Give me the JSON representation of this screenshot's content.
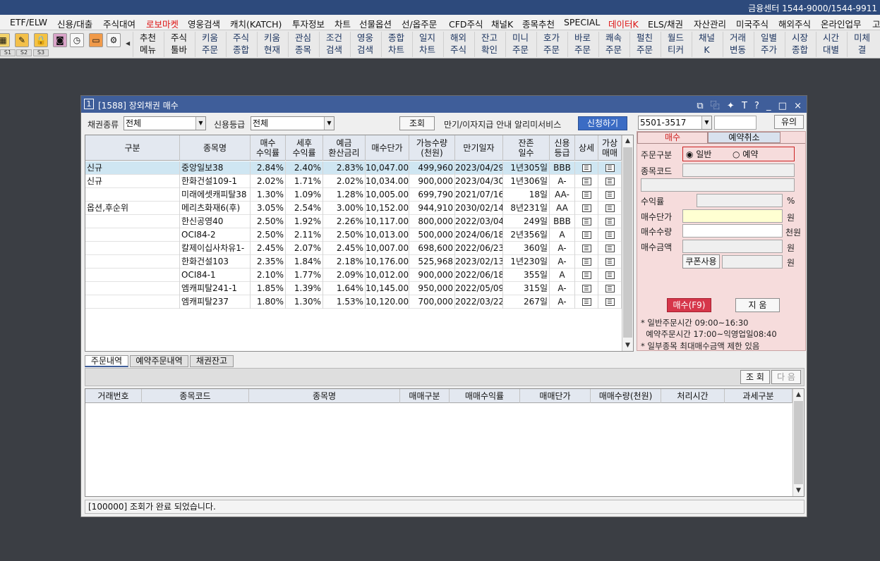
{
  "topbar": {
    "contact": "금융센터 1544-9000/1544-9911"
  },
  "menu": [
    "ETF/ELW",
    "신용/대출",
    "주식대여",
    "로보마켓",
    "영웅검색",
    "캐치(KATCH)",
    "투자정보",
    "차트",
    "선물옵션",
    "선/옵주문",
    "CFD주식",
    "채널K",
    "종목추천",
    "SPECIAL",
    "데이터K",
    "ELS/채권",
    "자산관리",
    "미국주식",
    "해외주식",
    "온라인업무",
    "고"
  ],
  "menu_highlight_color": "#d11",
  "toolbar": {
    "slots": [
      "S1",
      "S2",
      "S3"
    ],
    "buttons": [
      {
        "l1": "추천",
        "l2": "메뉴"
      },
      {
        "l1": "주식",
        "l2": "툴바"
      },
      {
        "l1": "키움",
        "l2": "주문"
      },
      {
        "l1": "주식",
        "l2": "종합"
      },
      {
        "l1": "키움",
        "l2": "현재"
      },
      {
        "l1": "관심",
        "l2": "종목"
      },
      {
        "l1": "조건",
        "l2": "검색"
      },
      {
        "l1": "영웅",
        "l2": "검색"
      },
      {
        "l1": "종합",
        "l2": "차트"
      },
      {
        "l1": "일지",
        "l2": "차트"
      },
      {
        "l1": "해외",
        "l2": "주식"
      },
      {
        "l1": "잔고",
        "l2": "확인"
      },
      {
        "l1": "미니",
        "l2": "주문"
      },
      {
        "l1": "호가",
        "l2": "주문"
      },
      {
        "l1": "바로",
        "l2": "주문"
      },
      {
        "l1": "쾌속",
        "l2": "주문"
      },
      {
        "l1": "펄친",
        "l2": "주문"
      },
      {
        "l1": "월드",
        "l2": "티커"
      },
      {
        "l1": "채널",
        "l2": "K"
      },
      {
        "l1": "거래",
        "l2": "변동"
      },
      {
        "l1": "일별",
        "l2": "주가"
      },
      {
        "l1": "시장",
        "l2": "종합"
      },
      {
        "l1": "시간",
        "l2": "대별"
      },
      {
        "l1": "미체",
        "l2": "결"
      }
    ]
  },
  "window": {
    "number": "1",
    "title": "[1588] 장외채권 매수",
    "controls": "⧉ ⿻ ✦ T ? _ □ ×"
  },
  "filters": {
    "bond_type_label": "채권종류",
    "bond_type_value": "전체",
    "credit_label": "신용등급",
    "credit_value": "전체",
    "search_button": "조회",
    "notice_text": "만기/이자지급 안내 알리미서비스",
    "apply_button": "신청하기"
  },
  "table": {
    "headers": [
      "구분",
      "종목명",
      "매수\n수익률",
      "세후\n수익률",
      "예금\n환산금리",
      "매수단가",
      "가능수량\n(천원)",
      "만기일자",
      "잔존\n일수",
      "신용\n등급",
      "상세",
      "가상\n매매"
    ],
    "rows": [
      [
        "신규",
        "중앙일보38",
        "2.84%",
        "2.40%",
        "2.83%",
        "10,047.00",
        "499,960",
        "2023/04/29",
        "1년305일",
        "BBB"
      ],
      [
        "신규",
        "한화건설109-1",
        "2.02%",
        "1.71%",
        "2.02%",
        "10,034.00",
        "900,000",
        "2023/04/30",
        "1년306일",
        "A-"
      ],
      [
        "",
        "미래에셋캐피탈38",
        "1.30%",
        "1.09%",
        "1.28%",
        "10,005.00",
        "699,790",
        "2021/07/16",
        "18일",
        "AA-"
      ],
      [
        "옵션,후순위",
        "메리츠화재6(후)",
        "3.05%",
        "2.54%",
        "3.00%",
        "10,152.00",
        "944,910",
        "2030/02/14",
        "8년231일",
        "AA"
      ],
      [
        "",
        "한신공영40",
        "2.50%",
        "1.92%",
        "2.26%",
        "10,117.00",
        "800,000",
        "2022/03/04",
        "249일",
        "BBB"
      ],
      [
        "",
        "OCI84-2",
        "2.50%",
        "2.11%",
        "2.50%",
        "10,013.00",
        "500,000",
        "2024/06/18",
        "2년356일",
        "A"
      ],
      [
        "",
        "칼제이십사차유1-",
        "2.45%",
        "2.07%",
        "2.45%",
        "10,007.00",
        "698,600",
        "2022/06/23",
        "360일",
        "A-"
      ],
      [
        "",
        "한화건설103",
        "2.35%",
        "1.84%",
        "2.18%",
        "10,176.00",
        "525,968",
        "2023/02/13",
        "1년230일",
        "A-"
      ],
      [
        "",
        "OCI84-1",
        "2.10%",
        "1.77%",
        "2.09%",
        "10,012.00",
        "900,000",
        "2022/06/18",
        "355일",
        "A"
      ],
      [
        "",
        "엠캐피탈241-1",
        "1.85%",
        "1.39%",
        "1.64%",
        "10,145.00",
        "950,000",
        "2022/05/09",
        "315일",
        "A-"
      ],
      [
        "",
        "엠캐피탈237",
        "1.80%",
        "1.30%",
        "1.53%",
        "10,120.00",
        "700,000",
        "2022/03/22",
        "267일",
        "A-"
      ]
    ],
    "detail_icon": "memo-icon"
  },
  "order_panel": {
    "account": "5501-3517",
    "notice_button": "유의",
    "tabs": [
      "매수",
      "예약취소"
    ],
    "order_type_label": "주문구분",
    "radio_general": "일반",
    "radio_reserve": "예약",
    "code_label": "종목코드",
    "yield_label": "수익률",
    "yield_unit": "%",
    "price_label": "매수단가",
    "price_unit": "원",
    "qty_label": "매수수량",
    "qty_unit": "천원",
    "amount_label": "매수금액",
    "amount_unit": "원",
    "coupon_button": "쿠폰사용",
    "coupon_unit": "원",
    "buy_button": "매수(F9)",
    "clear_button": "지  움",
    "note1": "* 일반주문시간 09:00~16:30",
    "note2": "  예약주문시간 17:00~익영업일08:40",
    "note3": "* 일부종목 최대매수금액 제한 있음"
  },
  "bottom": {
    "tabs": [
      "주문내역",
      "예약주문내역",
      "채권잔고"
    ],
    "search_button": "조 회",
    "next_button": "다 음",
    "headers": [
      "거래번호",
      "종목코드",
      "종목명",
      "매매구분",
      "매매수익률",
      "매매단가",
      "매매수량(천원)",
      "처리시간",
      "과세구분"
    ]
  },
  "status_text": "[100000] 조회가 완료 되었습니다."
}
